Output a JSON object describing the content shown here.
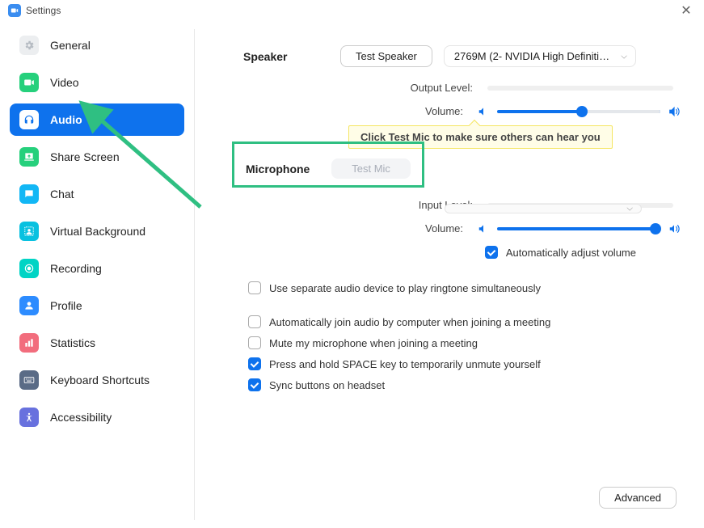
{
  "title": "Settings",
  "sidebar": {
    "items": [
      {
        "label": "General"
      },
      {
        "label": "Video"
      },
      {
        "label": "Audio"
      },
      {
        "label": "Share Screen"
      },
      {
        "label": "Chat"
      },
      {
        "label": "Virtual Background"
      },
      {
        "label": "Recording"
      },
      {
        "label": "Profile"
      },
      {
        "label": "Statistics"
      },
      {
        "label": "Keyboard Shortcuts"
      },
      {
        "label": "Accessibility"
      }
    ]
  },
  "speaker": {
    "label": "Speaker",
    "test_label": "Test Speaker",
    "device": "2769M (2- NVIDIA High Definitio...",
    "output_level_label": "Output Level:",
    "volume_label": "Volume:",
    "volume_percent": 52
  },
  "tooltip": "Click Test Mic to make sure others can hear you",
  "microphone": {
    "label": "Microphone",
    "test_label": "Test Mic",
    "input_level_label": "Input Level:",
    "volume_label": "Volume:",
    "volume_percent": 97,
    "auto_adjust_label": "Automatically adjust volume",
    "auto_adjust_checked": true
  },
  "options": [
    {
      "label": "Use separate audio device to play ringtone simultaneously",
      "checked": false
    },
    {
      "label": "Automatically join audio by computer when joining a meeting",
      "checked": false
    },
    {
      "label": "Mute my microphone when joining a meeting",
      "checked": false
    },
    {
      "label": "Press and hold SPACE key to temporarily unmute yourself",
      "checked": true
    },
    {
      "label": "Sync buttons on headset",
      "checked": true
    }
  ],
  "advanced_label": "Advanced"
}
